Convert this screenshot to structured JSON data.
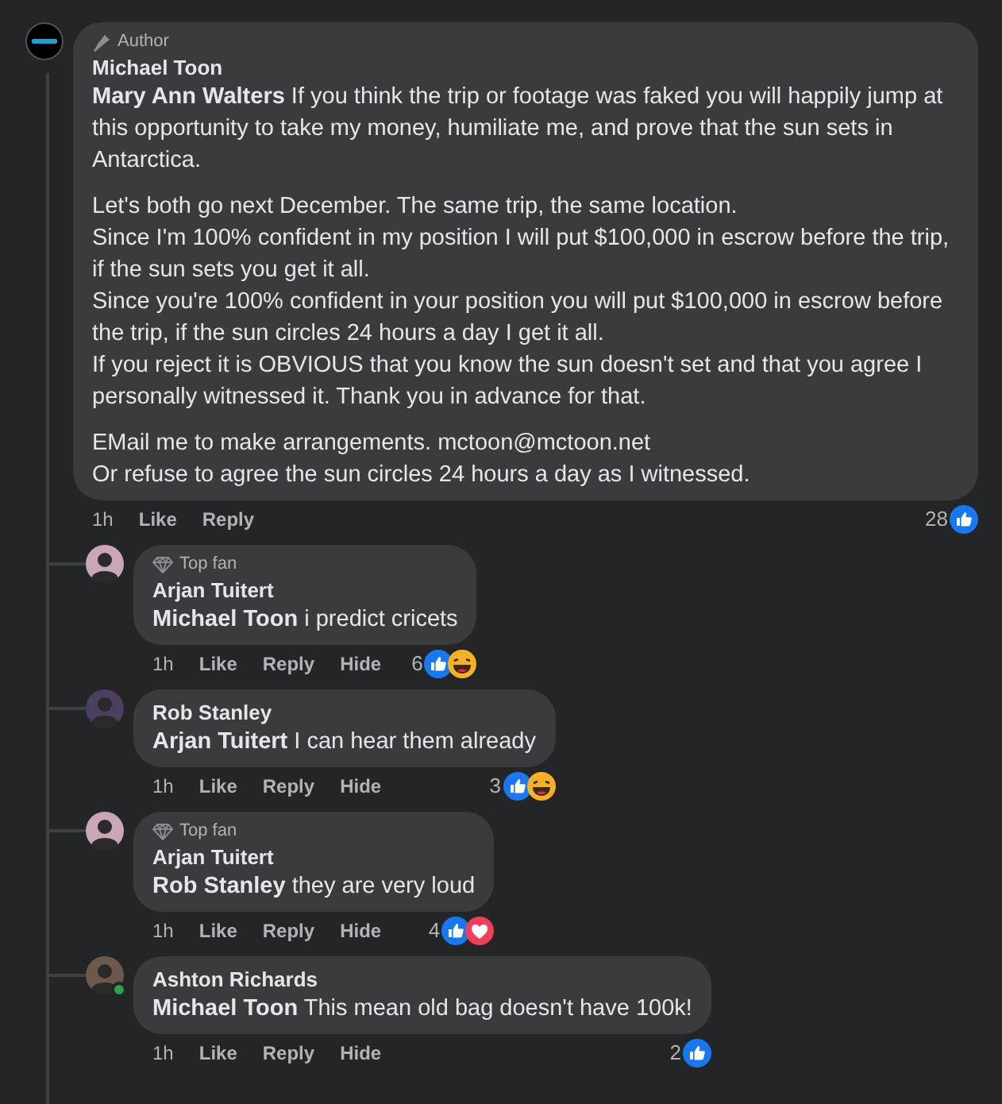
{
  "comment": {
    "badge": {
      "kind": "author",
      "text": "Author"
    },
    "author": "Michael Toon",
    "online": false,
    "paragraphs": [
      [
        "**Mary Ann Walters** If you think the trip or footage was faked you will happily jump at this opportunity to take my money, humiliate me, and prove that the sun sets in Antarctica."
      ],
      [
        "Let's both go next December. The same trip, the same location.",
        "Since I'm 100% confident in my position I will put $100,000 in escrow before the trip, if the sun sets you get it all.",
        "Since you're 100% confident in your position you will put $100,000 in escrow before the trip, if the sun circles 24 hours a day I get it all.",
        "If you reject it is OBVIOUS that you know the sun doesn't set and that you agree I personally witnessed it. Thank you in advance for that."
      ],
      [
        "EMail me to make arrangements. mctoon@mctoon.net",
        "Or refuse to agree the sun circles 24 hours a day as I witnessed."
      ]
    ],
    "actions": [
      "1h",
      "Like",
      "Reply"
    ],
    "reaction_count": "28",
    "reactions": [
      {
        "kind": "like"
      }
    ]
  },
  "replies": [
    {
      "badge": {
        "kind": "top_fan",
        "text": "Top fan"
      },
      "author": "Arjan Tuitert",
      "online": false,
      "paragraphs": [
        [
          "**Michael Toon** i predict cricets"
        ]
      ],
      "actions": [
        "1h",
        "Like",
        "Reply",
        "Hide"
      ],
      "reaction_count": "6",
      "reactions": [
        {
          "kind": "like"
        },
        {
          "kind": "haha"
        }
      ]
    },
    {
      "author": "Rob Stanley",
      "online": false,
      "paragraphs": [
        [
          "**Arjan Tuitert** I can hear them already"
        ]
      ],
      "actions": [
        "1h",
        "Like",
        "Reply",
        "Hide"
      ],
      "reaction_count": "3",
      "reactions": [
        {
          "kind": "like"
        },
        {
          "kind": "haha"
        }
      ]
    },
    {
      "badge": {
        "kind": "top_fan",
        "text": "Top fan"
      },
      "author": "Arjan Tuitert",
      "online": false,
      "paragraphs": [
        [
          "**Rob Stanley** they are very loud"
        ]
      ],
      "actions": [
        "1h",
        "Like",
        "Reply",
        "Hide"
      ],
      "reaction_count": "4",
      "reactions": [
        {
          "kind": "like"
        },
        {
          "kind": "love"
        }
      ]
    },
    {
      "author": "Ashton Richards",
      "online": true,
      "paragraphs": [
        [
          "**Michael Toon** This mean old bag doesn't have 100k!"
        ]
      ],
      "actions": [
        "1h",
        "Like",
        "Reply",
        "Hide"
      ],
      "reaction_count": "2",
      "reactions": [
        {
          "kind": "like"
        }
      ]
    }
  ]
}
